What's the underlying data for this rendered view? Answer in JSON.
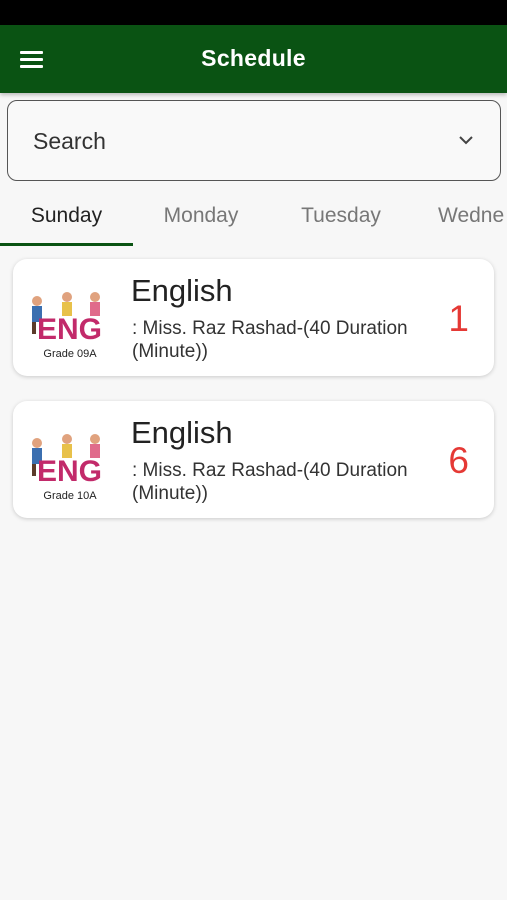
{
  "app_bar": {
    "title": "Schedule"
  },
  "search": {
    "label": "Search"
  },
  "tabs": [
    {
      "label": "Sunday"
    },
    {
      "label": "Monday"
    },
    {
      "label": "Tuesday"
    },
    {
      "label": "Wedne"
    }
  ],
  "classes": [
    {
      "subject": "English",
      "teacher": ": Miss. Raz Rashad-(40 Duration (Minute))",
      "period": "1",
      "grade": "Grade 09A",
      "thumb_text": "ENG"
    },
    {
      "subject": "English",
      "teacher": ": Miss. Raz Rashad-(40 Duration (Minute))",
      "period": "6",
      "grade": "Grade 10A",
      "thumb_text": "ENG"
    }
  ],
  "colors": {
    "app_bar": "#0a5313",
    "period_number": "#e53935",
    "tab_indicator": "#0a5313"
  }
}
